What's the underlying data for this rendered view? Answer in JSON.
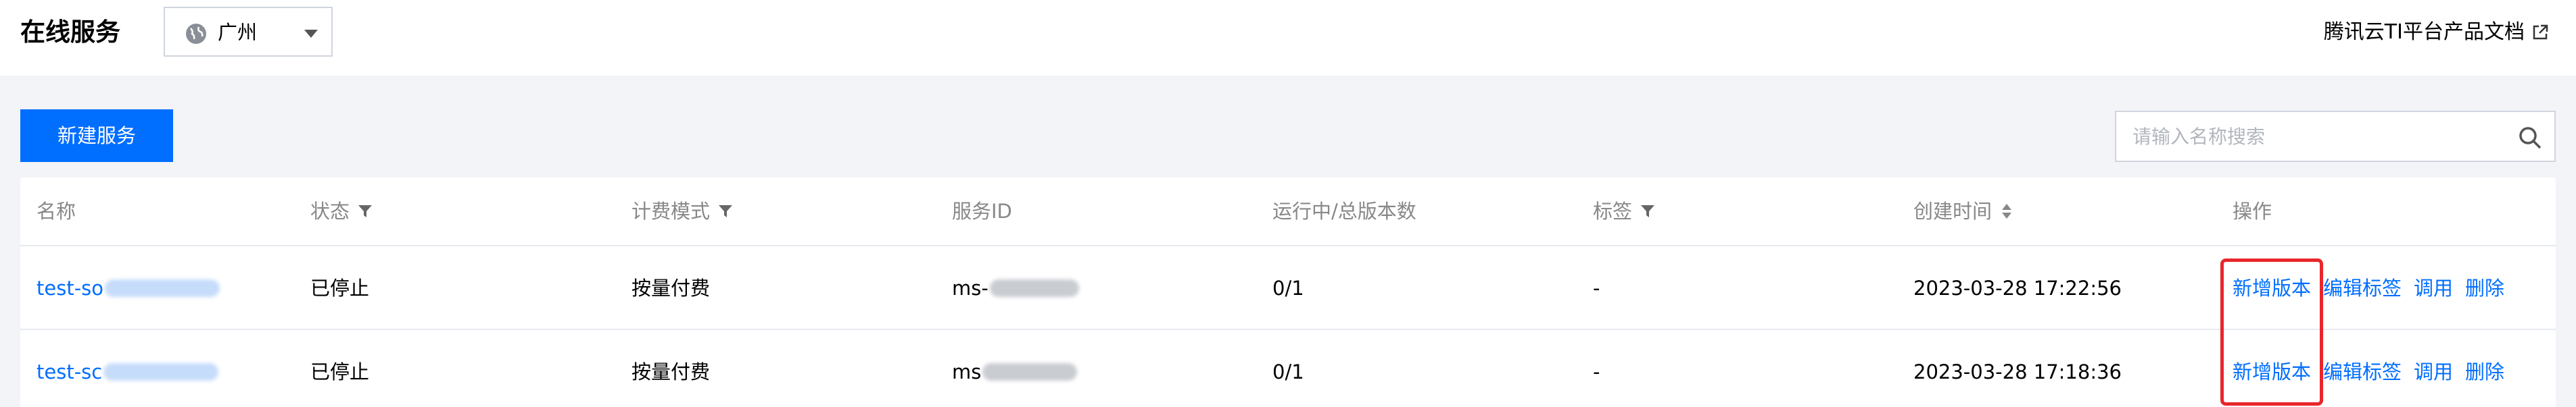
{
  "header": {
    "title": "在线服务",
    "region": "广州",
    "doc_link": "腾讯云TI平台产品文档"
  },
  "toolbar": {
    "new_button": "新建服务",
    "search_placeholder": "请输入名称搜索"
  },
  "table": {
    "columns": [
      "名称",
      "状态",
      "计费模式",
      "服务ID",
      "运行中/总版本数",
      "标签",
      "创建时间",
      "操作"
    ],
    "rows": [
      {
        "name": "test-so",
        "status": "已停止",
        "billing": "按量付费",
        "service_id": "ms-",
        "versions": "0/1",
        "tags": "-",
        "created": "2023-03-28 17:22:56",
        "actions": [
          "新增版本",
          "编辑标签",
          "调用",
          "删除"
        ]
      },
      {
        "name": "test-sc",
        "status": "已停止",
        "billing": "按量付费",
        "service_id": "ms",
        "versions": "0/1",
        "tags": "-",
        "created": "2023-03-28 17:18:36",
        "actions": [
          "新增版本",
          "编辑标签",
          "调用",
          "删除"
        ]
      }
    ]
  },
  "colors": {
    "accent": "#006eff",
    "highlight": "#e8262a"
  },
  "icons": [
    "globe-icon",
    "chevron-down-icon",
    "external-link-icon",
    "search-icon",
    "filter-icon",
    "sort-icon"
  ]
}
